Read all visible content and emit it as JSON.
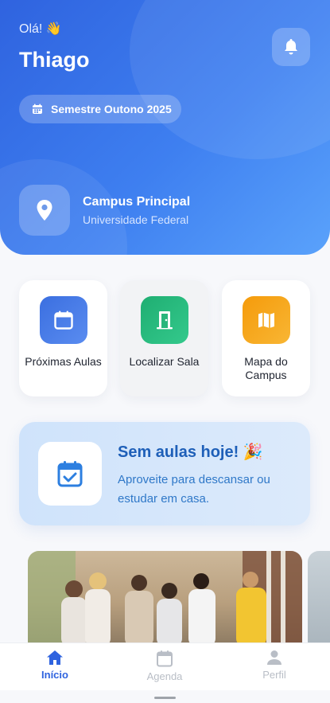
{
  "header": {
    "greeting": "Olá! 👋",
    "user_name": "Thiago",
    "semester": "Semestre Outono 2025",
    "campus_name": "Campus Principal",
    "institution": "Universidade Federal"
  },
  "quick_actions": [
    {
      "label": "Próximas Aulas",
      "icon": "calendar-icon",
      "color": "#3b6fe0"
    },
    {
      "label": "Localizar Sala",
      "icon": "door-icon",
      "color": "#25b77a"
    },
    {
      "label": "Mapa do Campus",
      "icon": "map-icon",
      "color": "#f5a416"
    }
  ],
  "banner": {
    "title": "Sem aulas hoje! 🎉",
    "subtitle": "Aproveite para descansar ou estudar em casa."
  },
  "tabbar": {
    "items": [
      {
        "label": "Início",
        "icon": "home-icon",
        "active": true
      },
      {
        "label": "Agenda",
        "icon": "calendar-icon",
        "active": false
      },
      {
        "label": "Perfil",
        "icon": "person-icon",
        "active": false
      }
    ],
    "active_color": "#2f63df",
    "inactive_color": "#b9bec6"
  },
  "colors": {
    "primary": "#2f63df",
    "primary_light": "#5aa2fb"
  }
}
